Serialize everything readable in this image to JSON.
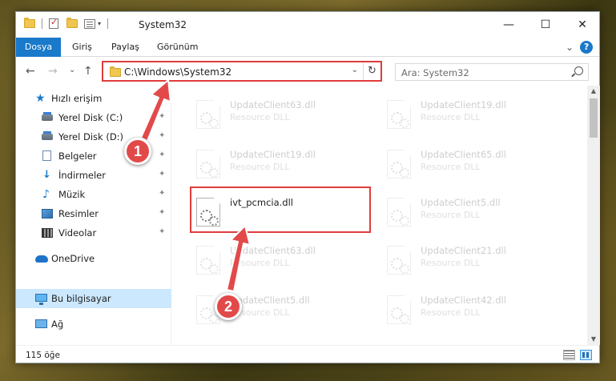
{
  "window": {
    "title": "System32",
    "minimize_glyph": "—",
    "maximize_glyph": "☐",
    "close_glyph": "✕"
  },
  "ribbon": {
    "tabs": [
      "Dosya",
      "Giriş",
      "Paylaş",
      "Görünüm"
    ],
    "expand_glyph": "⌄",
    "help_glyph": "?"
  },
  "nav": {
    "back_glyph": "←",
    "forward_glyph": "→",
    "recent_glyph": "⌄",
    "up_glyph": "↑",
    "address": "C:\\Windows\\System32",
    "address_dropdown_glyph": "⌄",
    "refresh_glyph": "↻",
    "search_placeholder": "Ara: System32"
  },
  "sidebar": {
    "items": [
      {
        "label": "Hızlı erişim",
        "icon": "star-icon",
        "pinned": false
      },
      {
        "label": "Yerel Disk (C:)",
        "icon": "drive-icon",
        "pinned": true
      },
      {
        "label": "Yerel Disk (D:)",
        "icon": "drive-icon",
        "pinned": true
      },
      {
        "label": "Belgeler",
        "icon": "document-icon",
        "pinned": true
      },
      {
        "label": "İndirmeler",
        "icon": "download-icon",
        "pinned": true
      },
      {
        "label": "Müzik",
        "icon": "music-icon",
        "pinned": true
      },
      {
        "label": "Resimler",
        "icon": "pictures-icon",
        "pinned": true
      },
      {
        "label": "Videolar",
        "icon": "video-icon",
        "pinned": true
      },
      {
        "label": "OneDrive",
        "icon": "cloud-icon",
        "pinned": false
      },
      {
        "label": "Bu bilgisayar",
        "icon": "computer-icon",
        "pinned": false,
        "selected": true
      },
      {
        "label": "Ağ",
        "icon": "network-icon",
        "pinned": false
      }
    ],
    "pin_glyph": "📌"
  },
  "files": [
    {
      "name": "UpdateClient63.dll",
      "type": "Resource DLL",
      "dim": true
    },
    {
      "name": "UpdateClient19.dll",
      "type": "Resource DLL",
      "dim": true
    },
    {
      "name": "UpdateClient19.dll",
      "type": "Resource DLL",
      "dim": true
    },
    {
      "name": "UpdateClient65.dll",
      "type": "Resource DLL",
      "dim": true
    },
    {
      "name": "ivt_pcmcia.dll",
      "type": "",
      "dim": false
    },
    {
      "name": "UpdateClient5.dll",
      "type": "Resource DLL",
      "dim": true
    },
    {
      "name": "UpdateClient63.dll",
      "type": "Resource DLL",
      "dim": true
    },
    {
      "name": "UpdateClient21.dll",
      "type": "Resource DLL",
      "dim": true
    },
    {
      "name": "UpdateClient5.dll",
      "type": "Resource DLL",
      "dim": true
    },
    {
      "name": "UpdateClient42.dll",
      "type": "Resource DLL",
      "dim": true
    }
  ],
  "status": {
    "item_count": "115 öğe"
  },
  "annotations": {
    "step1": "1",
    "step2": "2",
    "color": "#e24a4a"
  }
}
